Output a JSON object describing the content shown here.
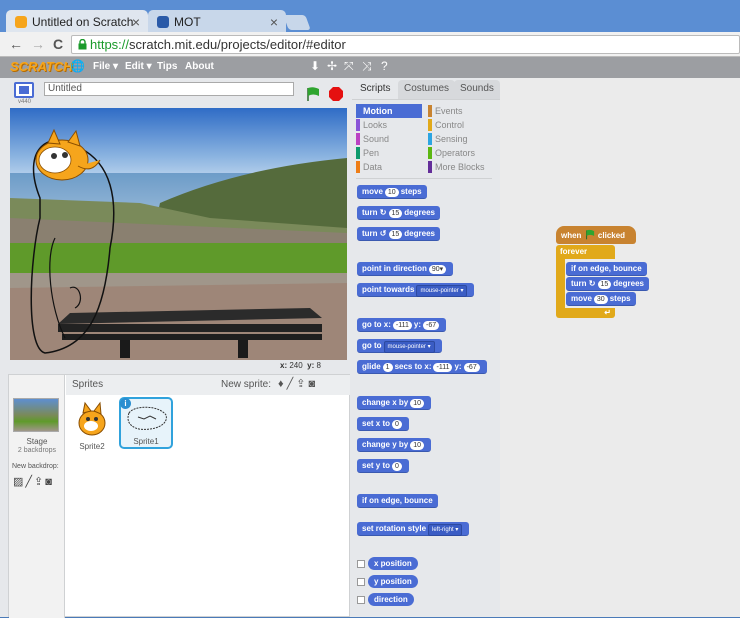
{
  "browser": {
    "tabs": [
      {
        "label": "Untitled on Scratch",
        "close": "×"
      },
      {
        "label": "MOT",
        "close": "×"
      }
    ],
    "nav": {
      "back": "←",
      "forward": "→",
      "reload": "C"
    },
    "url_scheme": "https://",
    "url_rest": "scratch.mit.edu/projects/editor/#editor"
  },
  "scratch_menu": {
    "logo": "SCRATCH",
    "items": [
      "File ▾",
      "Edit ▾",
      "Tips",
      "About"
    ]
  },
  "stage": {
    "project_title": "Untitled",
    "version": "v440",
    "coord_x_label": "x:",
    "coord_x": "240",
    "coord_y_label": "y:",
    "coord_y": "8"
  },
  "sprites_panel": {
    "header": "Sprites",
    "new_sprite_label": "New sprite:",
    "stage_label": "Stage",
    "stage_backdrops": "2 backdrops",
    "new_backdrop_label": "New backdrop:",
    "sprites": [
      {
        "name": "Sprite2"
      },
      {
        "name": "Sprite1",
        "selected": true,
        "info": "i"
      }
    ]
  },
  "palette": {
    "tabs": [
      "Scripts",
      "Costumes",
      "Sounds"
    ],
    "categories_left": [
      {
        "label": "Motion",
        "color": "#4a6cd4",
        "selected": true
      },
      {
        "label": "Looks",
        "color": "#8a55d7"
      },
      {
        "label": "Sound",
        "color": "#bb42c3"
      },
      {
        "label": "Pen",
        "color": "#0e9a6c"
      },
      {
        "label": "Data",
        "color": "#ee7d16"
      }
    ],
    "categories_right": [
      {
        "label": "Events",
        "color": "#c88330"
      },
      {
        "label": "Control",
        "color": "#e1a91a"
      },
      {
        "label": "Sensing",
        "color": "#2ca5e2"
      },
      {
        "label": "Operators",
        "color": "#5cb712"
      },
      {
        "label": "More Blocks",
        "color": "#632d99"
      }
    ],
    "blocks": {
      "move": {
        "a": "move",
        "v": "10",
        "b": "steps"
      },
      "turn_cw": {
        "a": "turn",
        "icon": "↻",
        "v": "15",
        "b": "degrees"
      },
      "turn_ccw": {
        "a": "turn",
        "icon": "↺",
        "v": "15",
        "b": "degrees"
      },
      "point_dir": {
        "a": "point in direction",
        "v": "90▾"
      },
      "point_towards": {
        "a": "point towards",
        "v": "mouse-pointer ▾"
      },
      "go_to_xy": {
        "a": "go to x:",
        "x": "-111",
        "m": "y:",
        "y": "-67"
      },
      "go_to": {
        "a": "go to",
        "v": "mouse-pointer ▾"
      },
      "glide": {
        "a": "glide",
        "v": "1",
        "b": "secs to x:",
        "x": "-111",
        "m": "y:",
        "y": "-67"
      },
      "change_x": {
        "a": "change x by",
        "v": "10"
      },
      "set_x": {
        "a": "set x to",
        "v": "0"
      },
      "change_y": {
        "a": "change y by",
        "v": "10"
      },
      "set_y": {
        "a": "set y to",
        "v": "0"
      },
      "bounce": {
        "a": "if on edge, bounce"
      },
      "rotation": {
        "a": "set rotation style",
        "v": "left-right ▾"
      },
      "x_pos": {
        "a": "x position"
      },
      "y_pos": {
        "a": "y position"
      },
      "direction": {
        "a": "direction"
      }
    }
  },
  "script": {
    "when": "when",
    "clicked": "clicked",
    "forever": "forever",
    "bounce": "if on edge, bounce",
    "turn_a": "turn",
    "turn_v": "15",
    "turn_b": "degrees",
    "move_a": "move",
    "move_v": "30",
    "move_b": "steps"
  },
  "colors": {
    "motion": "#4a6cd4",
    "events": "#c88330",
    "control": "#e1a91a"
  }
}
